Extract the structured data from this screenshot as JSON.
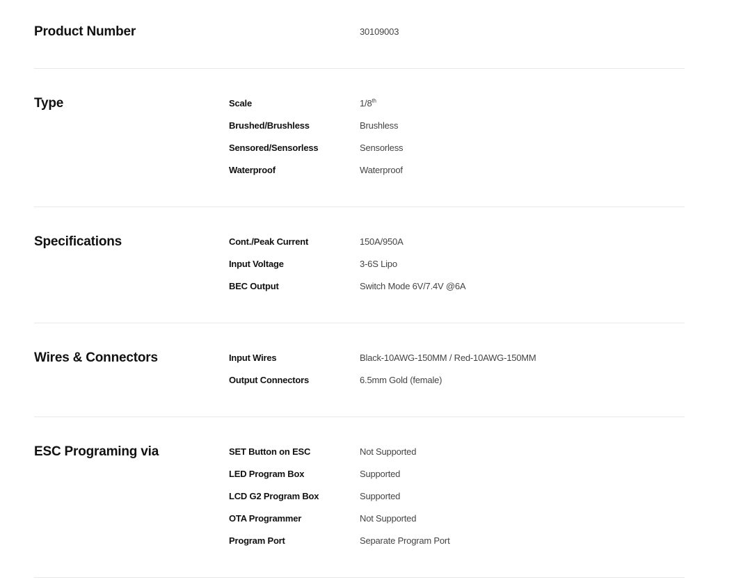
{
  "product_number": {
    "heading": "Product Number",
    "value": "30109003"
  },
  "sections": [
    {
      "heading": "Type",
      "rows": [
        {
          "label": "Scale",
          "value": "1/8",
          "sup": "th"
        },
        {
          "label": "Brushed/Brushless",
          "value": "Brushless"
        },
        {
          "label": "Sensored/Sensorless",
          "value": "Sensorless"
        },
        {
          "label": "Waterproof",
          "value": "Waterproof"
        }
      ]
    },
    {
      "heading": "Specifications",
      "rows": [
        {
          "label": "Cont./Peak Current",
          "value": "150A/950A"
        },
        {
          "label": "Input Voltage",
          "value": "3-6S Lipo"
        },
        {
          "label": "BEC Output",
          "value": "Switch Mode 6V/7.4V @6A"
        }
      ]
    },
    {
      "heading": "Wires & Connectors",
      "rows": [
        {
          "label": "Input Wires",
          "value": "Black-10AWG-150MM / Red-10AWG-150MM"
        },
        {
          "label": "Output Connectors",
          "value": "6.5mm Gold (female)"
        }
      ]
    },
    {
      "heading": "ESC Programing via",
      "rows": [
        {
          "label": "SET Button on ESC",
          "value": "Not Supported"
        },
        {
          "label": "LED Program Box",
          "value": "Supported"
        },
        {
          "label": "LCD G2 Program Box",
          "value": "Supported"
        },
        {
          "label": "OTA Programmer",
          "value": "Not Supported"
        },
        {
          "label": "Program Port",
          "value": "Separate Program Port"
        }
      ]
    }
  ]
}
